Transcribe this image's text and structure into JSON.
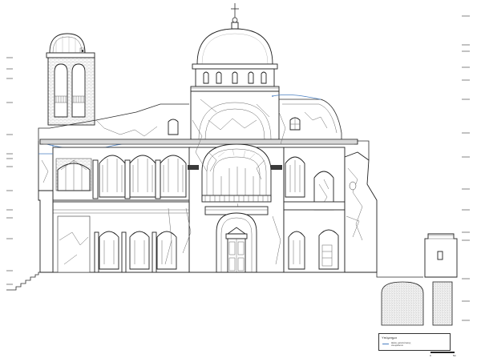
{
  "legend": {
    "title": "Υπόμνημα",
    "entry_label": "Θέση μετατόπισης ανωμαλιών",
    "line_color": "#4a7fc1"
  },
  "scale": {
    "start_label": "0",
    "end_label": "5m"
  }
}
